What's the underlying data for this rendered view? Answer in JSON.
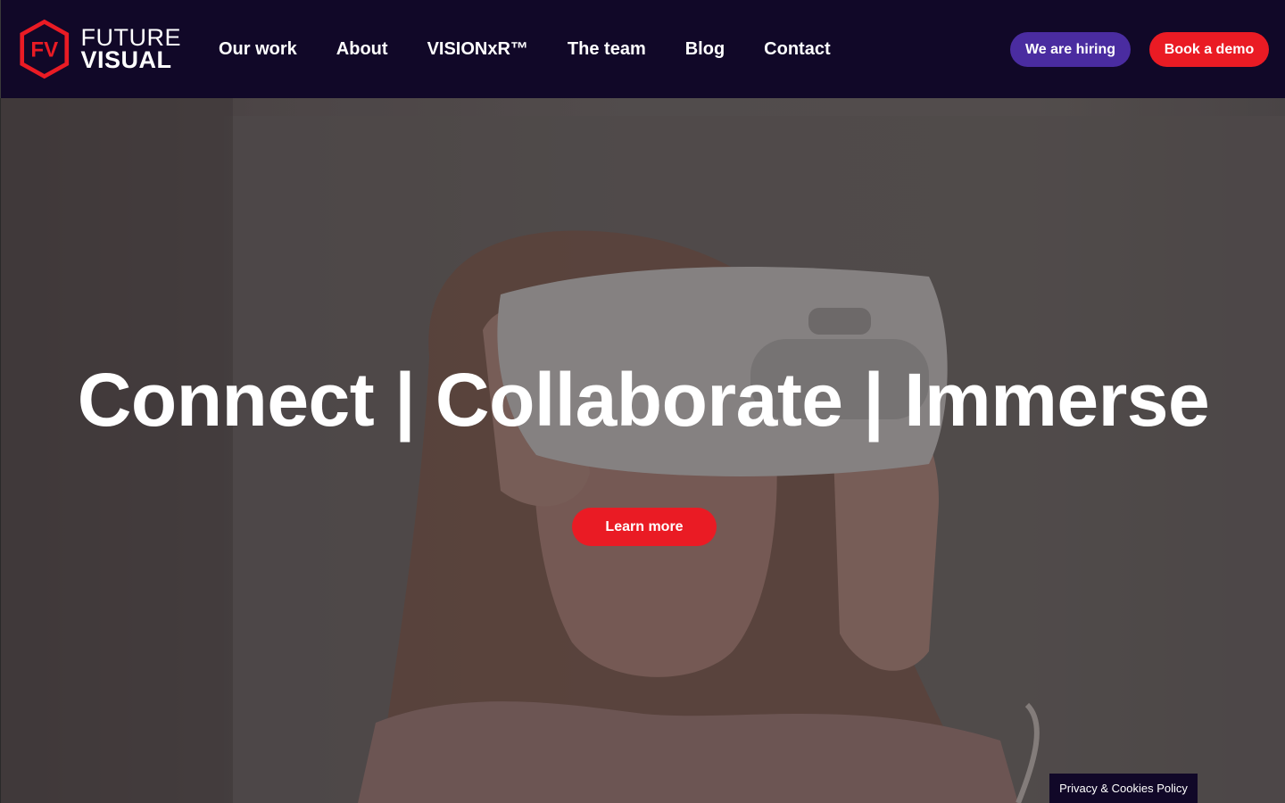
{
  "brand": {
    "logo_mark": "FV",
    "name_line1": "FUTURE",
    "name_line2": "VISUAL",
    "accent_color": "#ea1b24"
  },
  "nav": {
    "items": [
      {
        "label": "Our work"
      },
      {
        "label": "About"
      },
      {
        "label": "VISIONxR™"
      },
      {
        "label": "The team"
      },
      {
        "label": "Blog"
      },
      {
        "label": "Contact"
      }
    ]
  },
  "header_buttons": {
    "hiring_label": "We are hiring",
    "demo_label": "Book a demo",
    "hiring_color": "#4a2ca0",
    "demo_color": "#ea1b24"
  },
  "hero": {
    "title": "Connect | Collaborate | Immerse",
    "cta_label": "Learn more"
  },
  "footer": {
    "privacy_label": "Privacy & Cookies Policy"
  }
}
